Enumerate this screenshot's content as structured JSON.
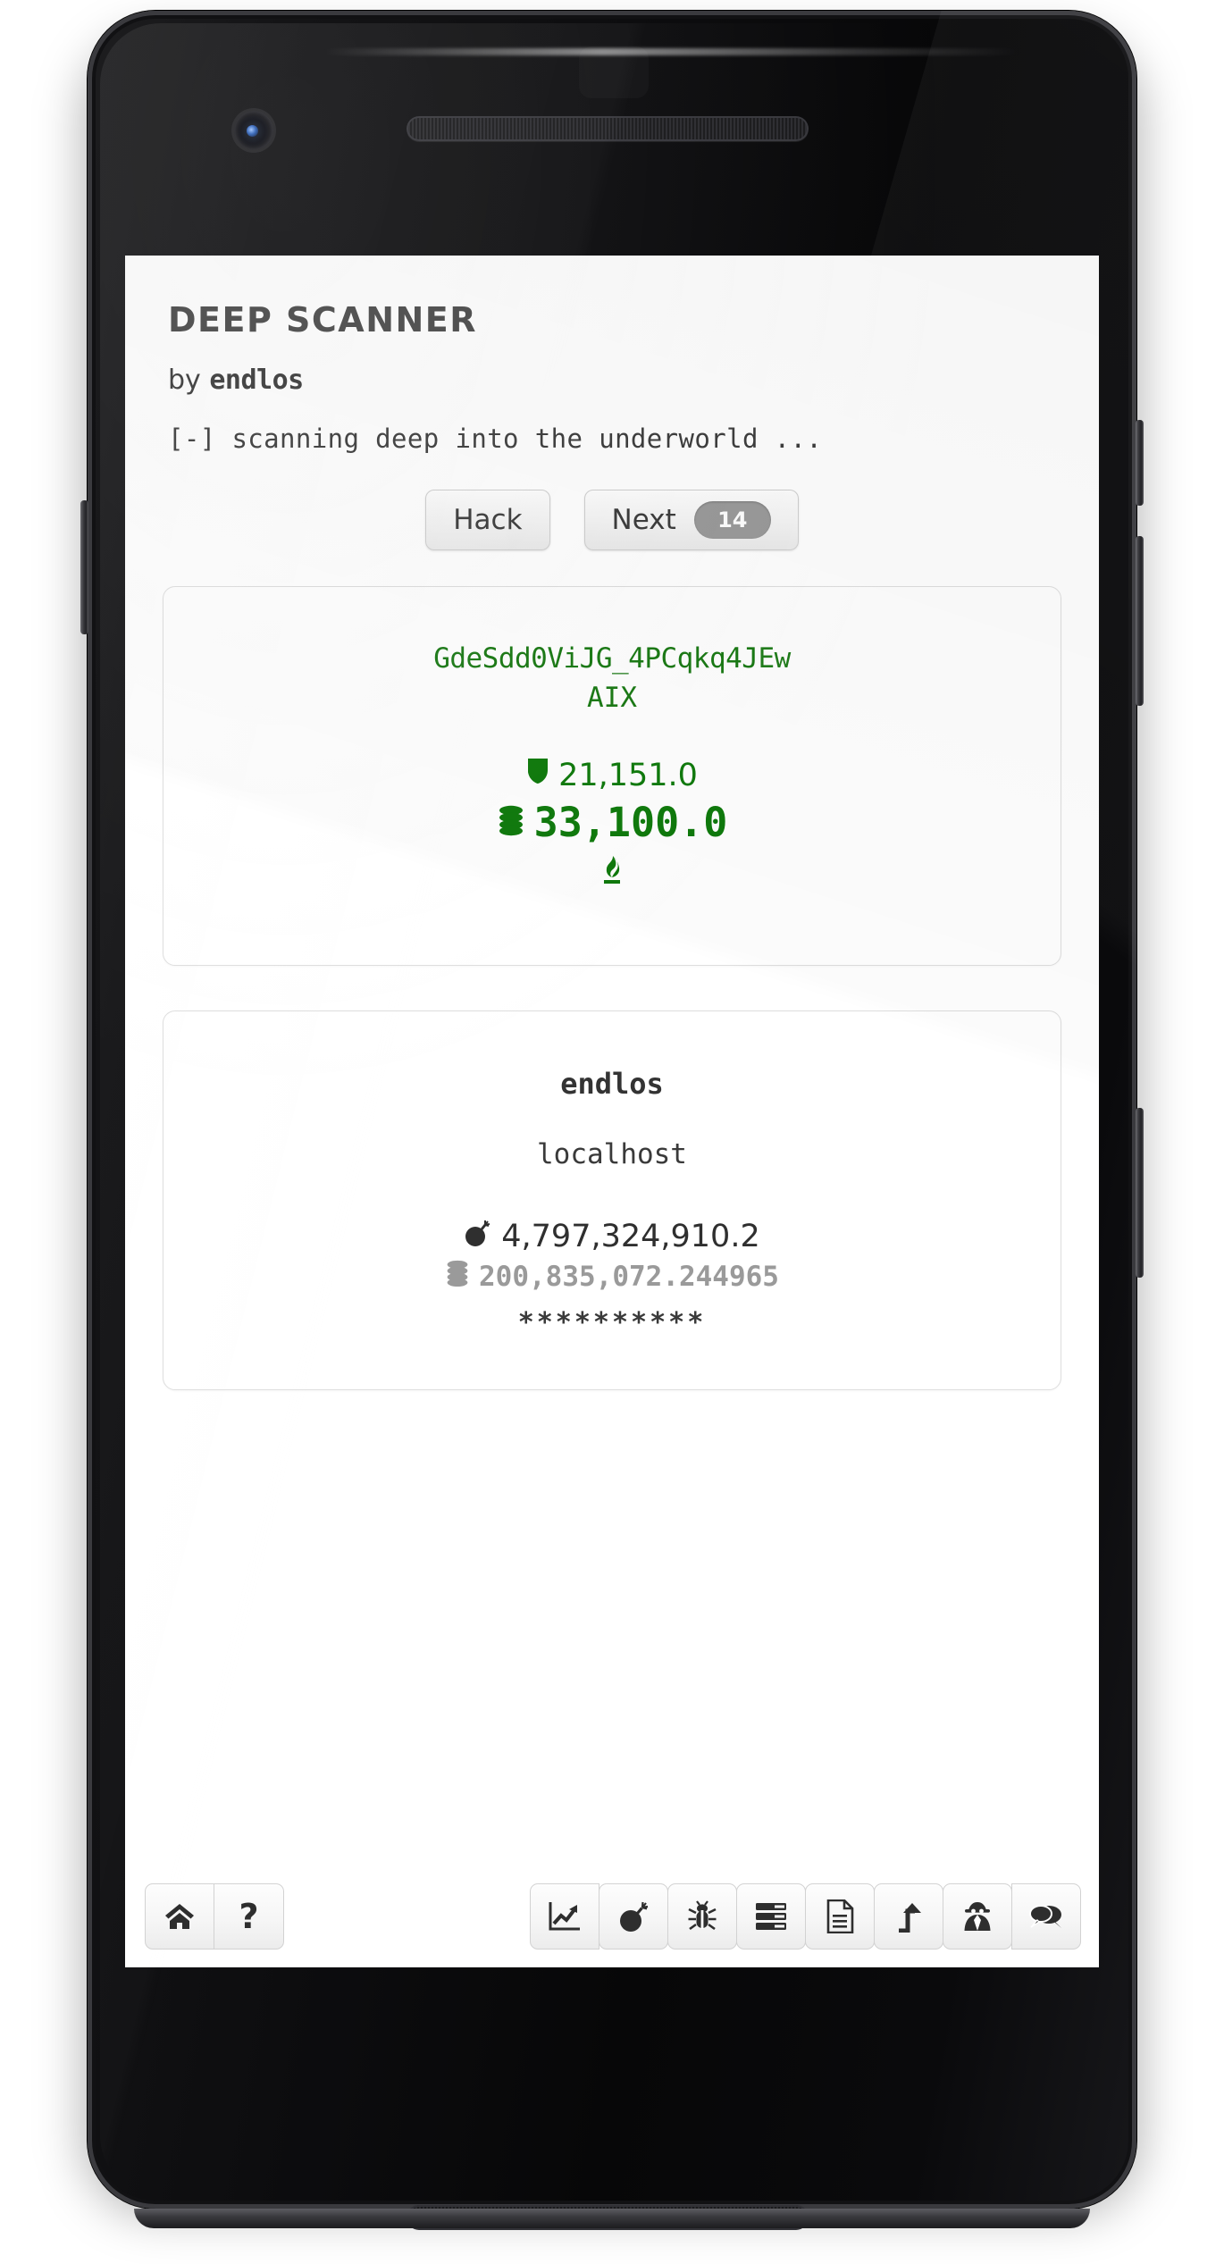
{
  "app": {
    "title": "DEEP SCANNER",
    "byline_prefix": "by ",
    "byline_author": "endlos",
    "status_line": "[-] scanning deep into the underworld ..."
  },
  "actions": {
    "hack_label": "Hack",
    "next_label": "Next",
    "next_badge": "14"
  },
  "target_card": {
    "hostname": "GdeSdd0ViJG_4PCqkq4JEw",
    "os": "AIX",
    "defense_icon": "shield-icon",
    "defense_value": "21,151.0",
    "money_icon": "coins-icon",
    "money_value": "33,100.0",
    "flame_icon": "flame-icon"
  },
  "player_card": {
    "name": "endlos",
    "hostname": "localhost",
    "attack_icon": "bomb-icon",
    "attack_value": "4,797,324,910.2",
    "money_icon": "coins-icon",
    "money_value": "200,835,072.244965",
    "masked_value": "**********"
  },
  "toolbar": {
    "left": [
      {
        "name": "home-icon",
        "label": "Home"
      },
      {
        "name": "help-icon",
        "label": "?"
      }
    ],
    "right": [
      {
        "name": "chart-icon",
        "label": "Stats"
      },
      {
        "name": "bomb-icon",
        "label": "Attack"
      },
      {
        "name": "bug-icon",
        "label": "Exploits"
      },
      {
        "name": "server-icon",
        "label": "Servers"
      },
      {
        "name": "document-icon",
        "label": "Logs"
      },
      {
        "name": "upgrade-arrow-icon",
        "label": "Upgrade"
      },
      {
        "name": "spy-icon",
        "label": "Spy"
      },
      {
        "name": "chat-icon",
        "label": "Chat"
      }
    ]
  },
  "colors": {
    "green": "#0f7a0c",
    "target_green": "#1a7a14",
    "text_dark": "#3a3a3a",
    "muted": "#9a9a9a",
    "badge_bg": "#9a9a9a"
  }
}
